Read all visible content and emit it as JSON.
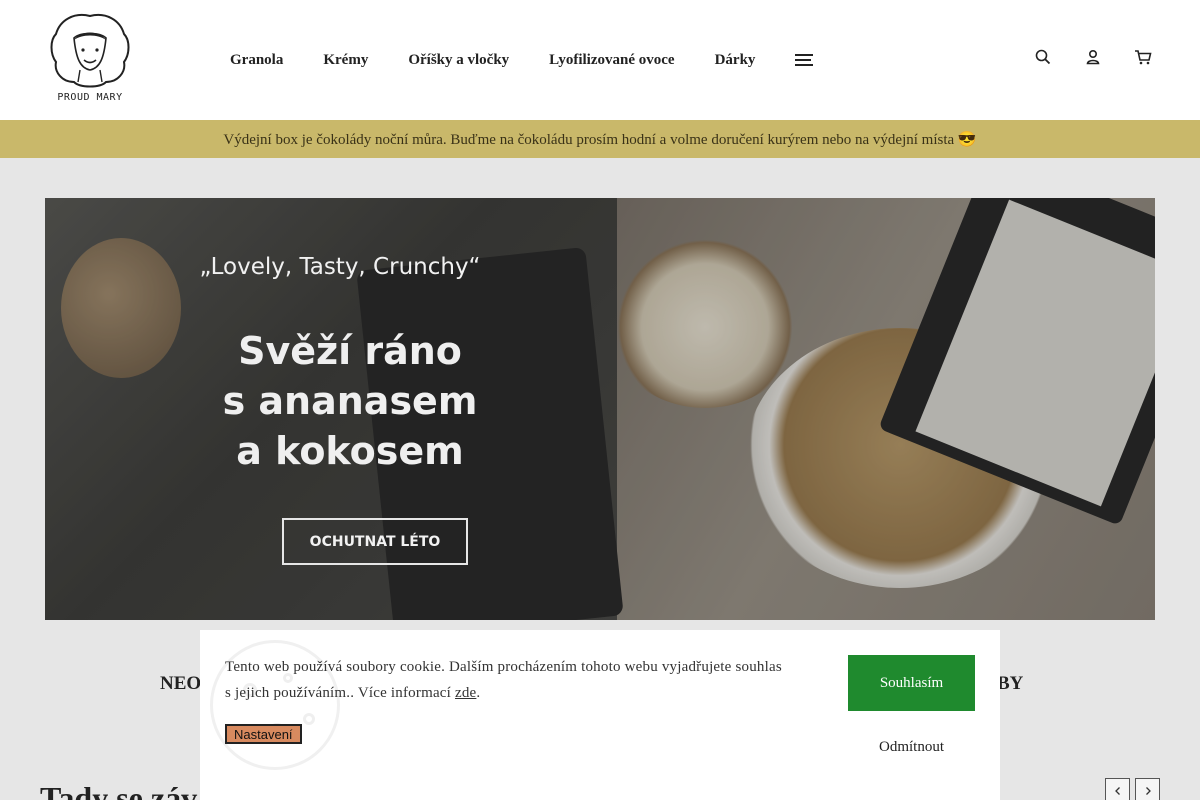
{
  "header": {
    "logo_text": "PROUD MARY",
    "nav": [
      {
        "label": "Granola"
      },
      {
        "label": "Krémy"
      },
      {
        "label": "Oříšky a vločky"
      },
      {
        "label": "Lyofilizované ovoce"
      },
      {
        "label": "Dárky"
      }
    ],
    "icons": [
      "search-icon",
      "user-icon",
      "cart-icon",
      "menu-icon"
    ]
  },
  "notice": {
    "text": "Výdejní box je čokolády noční můra. Buďme na čokoládu prosím hodní a volme doručení kurýrem nebo na výdejní místa 😎"
  },
  "hero": {
    "quote": "„Lovely, Tasty, Crunchy“",
    "title_lines": [
      "Svěží ráno",
      "s ananasem",
      "a kokosem"
    ],
    "cta_label": "OCHUTNAT LÉTO"
  },
  "sections": {
    "left_heading": "NEO",
    "right_heading": "BY",
    "big_heading": "Tady se záv"
  },
  "cookie": {
    "text": "Tento web používá soubory cookie. Dalším procházením tohoto webu vyjadřujete souhlas s jejich používáním.. Více informací ",
    "link_label": "zde",
    "text_end": ".",
    "settings_label": "Nastavení",
    "accept_label": "Souhlasím",
    "reject_label": "Odmítnout"
  },
  "colors": {
    "notice_bg": "#c9b86a",
    "accept_bg": "#1f8a2e",
    "settings_bg": "#d88a5f"
  }
}
